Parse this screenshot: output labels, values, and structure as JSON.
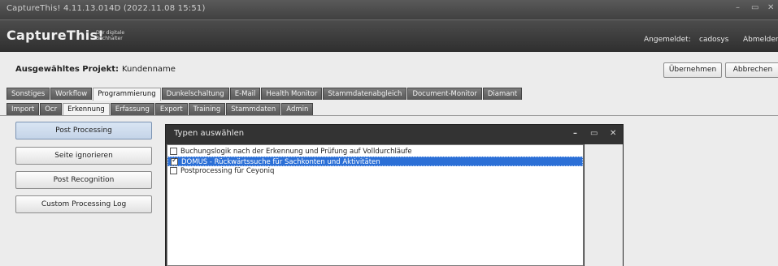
{
  "window": {
    "title": "CaptureThis! 4.11.13.014D (2022.11.08 15:51)",
    "controls": [
      "–",
      "▭",
      "✕"
    ]
  },
  "header": {
    "logo": "CaptureThis!",
    "logo_sub": "Der digitale Buchhalter",
    "login_label": "Angemeldet:",
    "login_user": "cadosys",
    "logout": "Abmelden"
  },
  "project": {
    "label": "Ausgewähltes Projekt:",
    "value": "Kundenname",
    "apply": "Übernehmen",
    "cancel": "Abbrechen"
  },
  "tabs_main": {
    "items": [
      "Sonstiges",
      "Workflow",
      "Programmierung",
      "Dunkelschaltung",
      "E-Mail",
      "Health Monitor",
      "Stammdatenabgleich",
      "Document-Monitor",
      "Diamant"
    ],
    "active": "Programmierung"
  },
  "tabs_sub": {
    "items": [
      "Import",
      "Ocr",
      "Erkennung",
      "Erfassung",
      "Export",
      "Training",
      "Stammdaten",
      "Admin"
    ],
    "active": "Erkennung"
  },
  "side_buttons": [
    "Post Processing",
    "Seite ignorieren",
    "Post Recognition",
    "Custom Processing Log"
  ],
  "dialog": {
    "title": "Typen auswählen",
    "controls": [
      "–",
      "▭",
      "✕"
    ],
    "items": [
      {
        "label": "Buchungslogik nach der Erkennung und Prüfung auf Volldurchläufe",
        "checked": false,
        "selected": false
      },
      {
        "label": "DOMUS - Rückwärtssuche für Sachkonten und Aktivitäten",
        "checked": true,
        "selected": true
      },
      {
        "label": "Postprocessing für Ceyoniq",
        "checked": false,
        "selected": false
      }
    ]
  },
  "colors": {
    "selection": "#2b6fd6",
    "header_bg": "#3a3a3a",
    "tab_bg": "#666666"
  }
}
